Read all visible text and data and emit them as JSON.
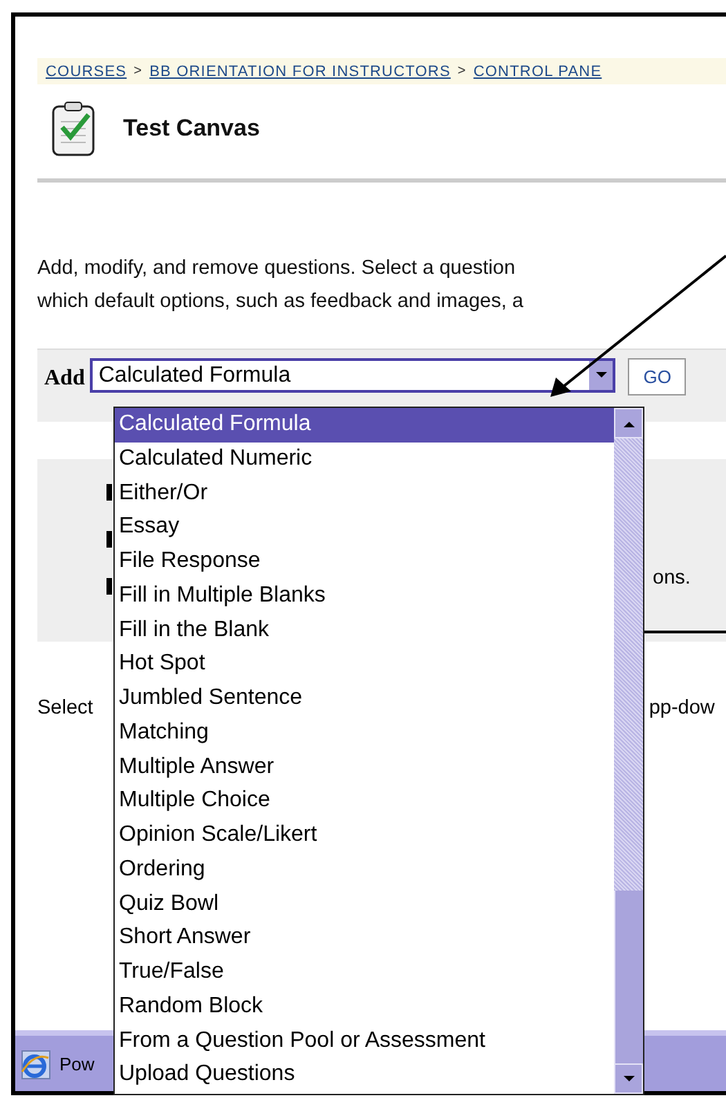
{
  "breadcrumb": [
    {
      "label": "COURSES"
    },
    {
      "label": "BB ORIENTATION FOR INSTRUCTORS"
    },
    {
      "label": "CONTROL PANE"
    }
  ],
  "breadcrumb_separator": ">",
  "page_title": "Test Canvas",
  "description": [
    "Add, modify, and remove questions. Select a question",
    "which default options, such as feedback and images, a"
  ],
  "add_bar": {
    "label": "Add",
    "select_value": "Calculated Formula",
    "go_button": "GO"
  },
  "partial_texts": {
    "box_text": "ons.",
    "select_text": "Select",
    "select_tail": "pp-dow",
    "taskbar_text": "Pow"
  },
  "dropdown_options": [
    {
      "label": "Calculated Formula",
      "selected": true
    },
    {
      "label": "Calculated Numeric",
      "selected": false
    },
    {
      "label": "Either/Or",
      "selected": false
    },
    {
      "label": "Essay",
      "selected": false
    },
    {
      "label": "File Response",
      "selected": false
    },
    {
      "label": "Fill in Multiple Blanks",
      "selected": false
    },
    {
      "label": "Fill in the Blank",
      "selected": false
    },
    {
      "label": "Hot Spot",
      "selected": false
    },
    {
      "label": "Jumbled Sentence",
      "selected": false
    },
    {
      "label": "Matching",
      "selected": false
    },
    {
      "label": "Multiple Answer",
      "selected": false
    },
    {
      "label": "Multiple Choice",
      "selected": false
    },
    {
      "label": "Opinion Scale/Likert",
      "selected": false
    },
    {
      "label": "Ordering",
      "selected": false
    },
    {
      "label": "Quiz Bowl",
      "selected": false
    },
    {
      "label": "Short Answer",
      "selected": false
    },
    {
      "label": "True/False",
      "selected": false
    },
    {
      "label": "Random Block",
      "selected": false
    },
    {
      "label": "From a Question Pool or Assessment",
      "selected": false
    },
    {
      "label": "Upload Questions",
      "selected": false
    }
  ]
}
